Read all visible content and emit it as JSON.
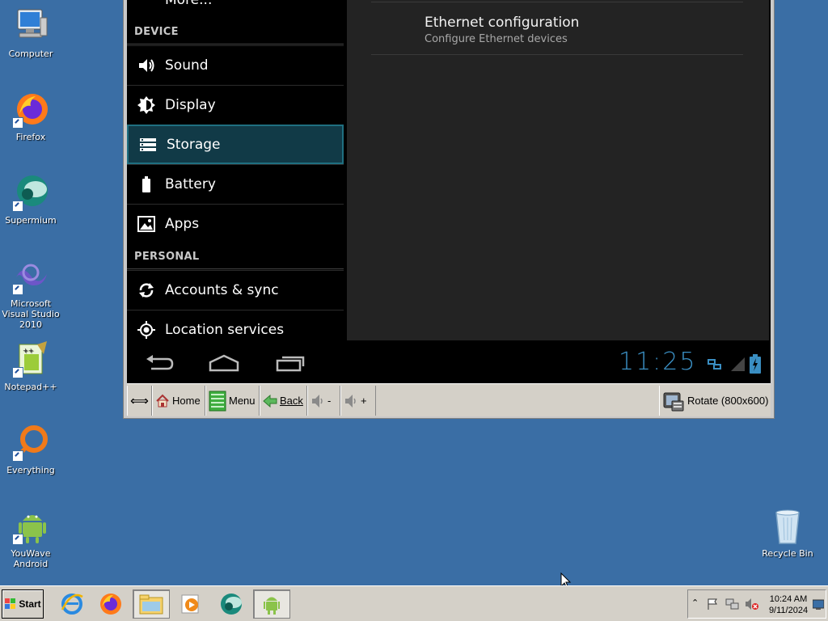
{
  "desktop": {
    "icons": [
      {
        "label": "Computer",
        "icon": "computer-icon"
      },
      {
        "label": "Firefox",
        "icon": "firefox-icon"
      },
      {
        "label": "Supermium",
        "icon": "supermium-icon"
      },
      {
        "label": "Microsoft Visual Studio 2010",
        "icon": "visual-studio-icon"
      },
      {
        "label": "Notepad++",
        "icon": "notepad-plus-plus-icon"
      },
      {
        "label": "Everything",
        "icon": "everything-icon"
      },
      {
        "label": "YouWave Android",
        "icon": "android-icon"
      }
    ],
    "recycle_bin": {
      "label": "Recycle Bin",
      "icon": "recycle-bin-icon"
    }
  },
  "android": {
    "left_panel": {
      "more_label": "More...",
      "device_header": "DEVICE",
      "device_items": [
        {
          "label": "Sound",
          "icon": "sound-icon"
        },
        {
          "label": "Display",
          "icon": "display-icon"
        },
        {
          "label": "Storage",
          "icon": "storage-icon",
          "selected": true
        },
        {
          "label": "Battery",
          "icon": "battery-icon"
        },
        {
          "label": "Apps",
          "icon": "apps-icon"
        }
      ],
      "personal_header": "PERSONAL",
      "personal_items": [
        {
          "label": "Accounts & sync",
          "icon": "sync-icon"
        },
        {
          "label": "Location services",
          "icon": "location-icon"
        }
      ]
    },
    "right_panel": {
      "ethernet_title": "Ethernet configuration",
      "ethernet_subtitle": "Configure Ethernet devices"
    },
    "navbar": {
      "clock": "11:25"
    }
  },
  "toolbar": {
    "home_label": "Home",
    "menu_label": "Menu",
    "back_label": "Back",
    "vol_down_label": "-",
    "vol_up_label": "+",
    "rotate_label": "Rotate (800x600)"
  },
  "taskbar": {
    "start_label": "Start",
    "time": "10:24 AM",
    "date": "9/11/2024"
  },
  "colors": {
    "desktop_bg": "#3a6ea5",
    "selected_row": "#113a47",
    "clock": "#3a8ec2"
  }
}
